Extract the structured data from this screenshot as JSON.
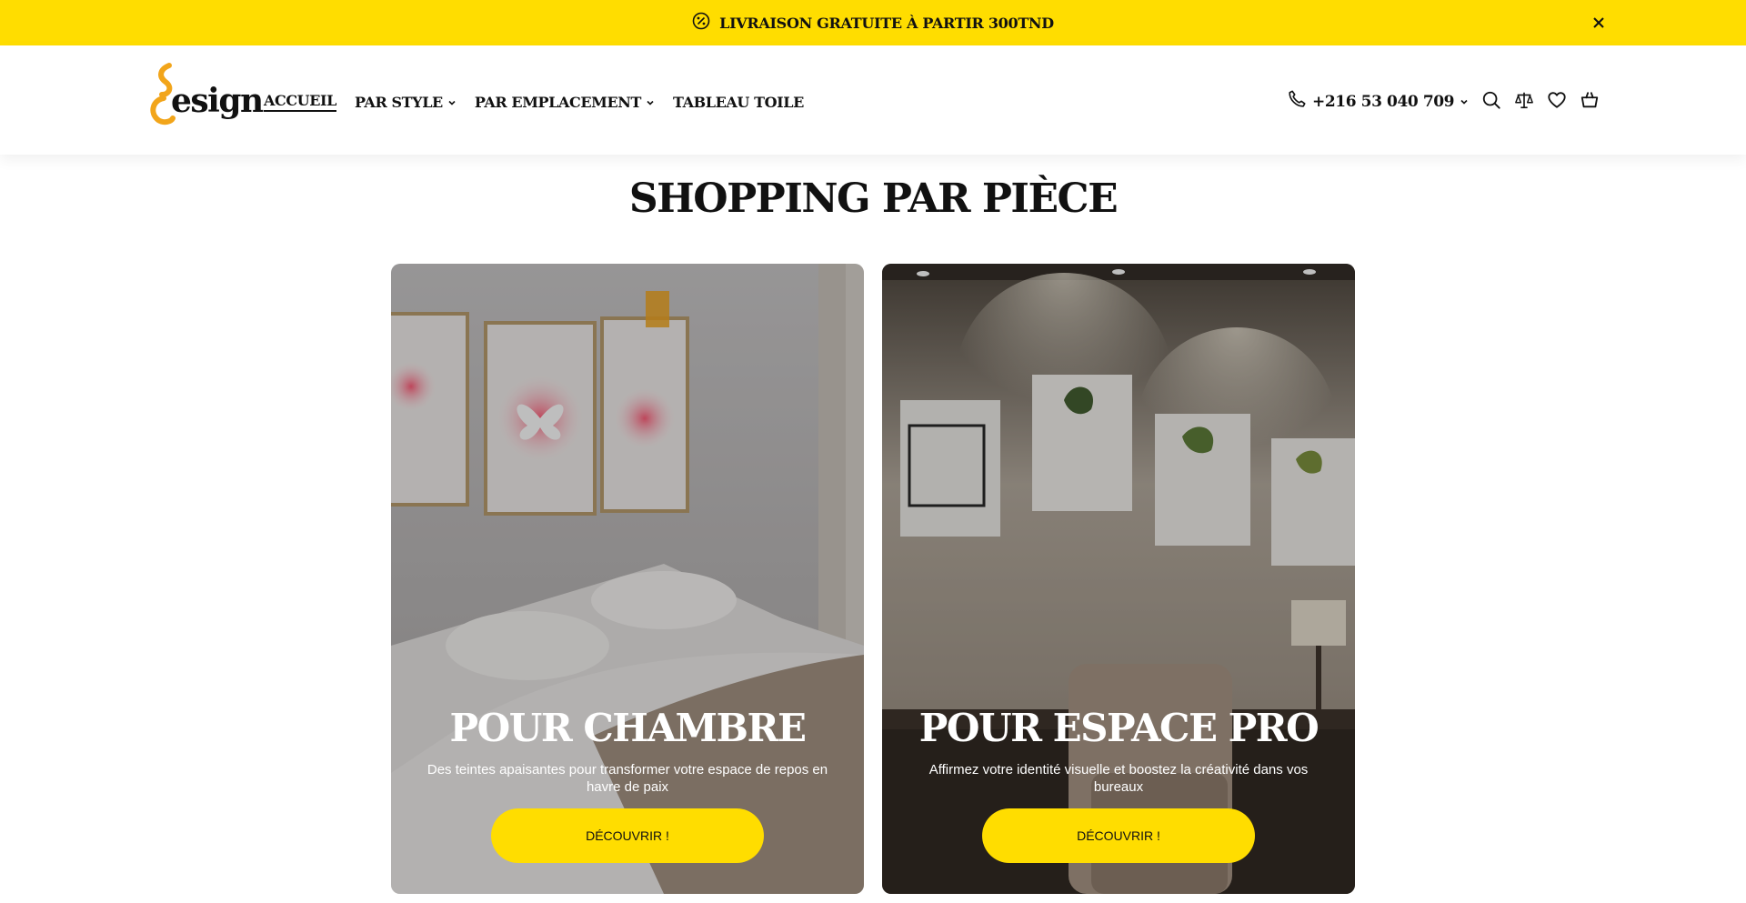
{
  "announcement": {
    "text": "LIVRAISON GRATUITE À PARTIR 300TND",
    "icon": "discount-badge-icon",
    "close_icon": "close-icon"
  },
  "header": {
    "logo_text": "esign",
    "nav": [
      {
        "label": "ACCUEIL",
        "active": true,
        "dropdown": false
      },
      {
        "label": "PAR STYLE",
        "active": false,
        "dropdown": true
      },
      {
        "label": "PAR EMPLACEMENT",
        "active": false,
        "dropdown": true
      },
      {
        "label": "TABLEAU TOILE",
        "active": false,
        "dropdown": false
      }
    ],
    "phone": "+216 53 040 709",
    "icons": [
      "search-icon",
      "compare-icon",
      "wishlist-heart-icon",
      "cart-basket-icon"
    ]
  },
  "section": {
    "title": "SHOPPING PAR PIÈCE",
    "cards": [
      {
        "title": "POUR CHAMBRE",
        "description": "Des teintes apaisantes pour transformer votre espace de repos en havre de paix",
        "button": "DÉCOUVRIR !"
      },
      {
        "title": "POUR ESPACE PRO",
        "description": "Affirmez votre identité visuelle et boostez la créativité dans vos bureaux",
        "button": "DÉCOUVRIR !"
      }
    ]
  },
  "colors": {
    "accent_yellow": "#FFDD00",
    "logo_orange": "#F2A51A",
    "text_dark": "#111111"
  }
}
